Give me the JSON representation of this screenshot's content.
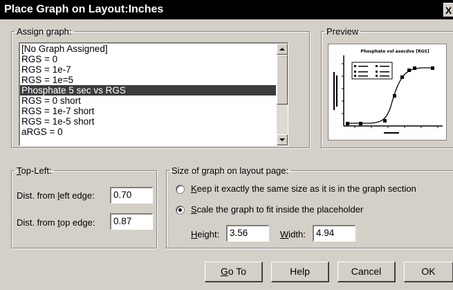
{
  "dialog": {
    "title": "Place Graph on Layout:Inches",
    "close_glyph": "X"
  },
  "assign_graph": {
    "legend": "Assign graph:",
    "items": [
      "[No Graph Assigned]",
      "RGS = 0",
      "RGS = 1e-7",
      "RGS = 1e=5",
      "Phosphate 5 sec vs RGS",
      "RGS = 0 short",
      "RGS = 1e-7 short",
      "RGS = 1e-5 short",
      "aRGS = 0"
    ],
    "selected_index": 4
  },
  "preview": {
    "legend": "Preview",
    "thumbnail_title": "Phosphate vol asecdve [RGS]",
    "colors": {
      "curve": "#000000"
    }
  },
  "top_left": {
    "legend_first": "T",
    "legend_rest": "op-Left:",
    "left_edge_label_pre": "Dist. from ",
    "left_edge_label_u": "l",
    "left_edge_label_post": "eft edge:",
    "left_edge_value": "0.70",
    "top_edge_label_pre": "Dist. from ",
    "top_edge_label_u": "t",
    "top_edge_label_post": "op edge:",
    "top_edge_value": "0.87"
  },
  "size": {
    "legend": "Size of graph on layout page:",
    "option_keep_u": "K",
    "option_keep_rest": "eep it exactly the same size as it is in the graph section",
    "option_scale_u": "S",
    "option_scale_rest": "cale the graph to fit inside the placeholder",
    "selected_option": "scale",
    "height_label_u": "H",
    "height_label_rest": "eight:",
    "height_value": "3.56",
    "width_label_u": "W",
    "width_label_rest": "idth:",
    "width_value": "4.94"
  },
  "buttons": {
    "goto_u": "G",
    "goto_rest": "o To",
    "help": "Help",
    "cancel": "Cancel",
    "ok": "OK"
  }
}
